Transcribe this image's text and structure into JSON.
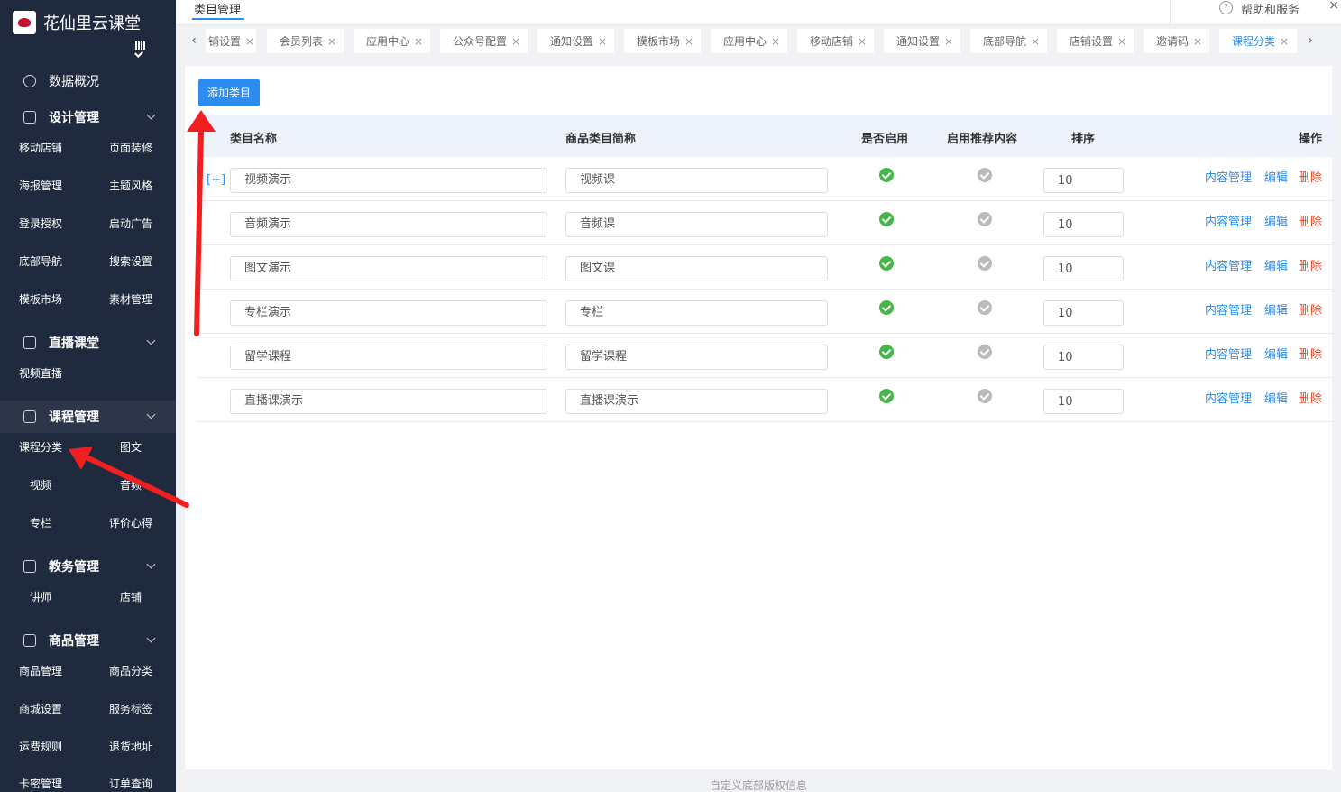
{
  "brand": {
    "name": "花仙里云课堂"
  },
  "sidebar": {
    "overview": "数据概况",
    "groups": [
      {
        "title": "设计管理",
        "items": [
          "移动店铺",
          "页面装修",
          "海报管理",
          "主题风格",
          "登录授权",
          "启动广告",
          "底部导航",
          "搜索设置",
          "模板市场",
          "素材管理"
        ]
      },
      {
        "title": "直播课堂",
        "items": [
          "视频直播"
        ]
      },
      {
        "title": "课程管理",
        "items": [
          "课程分类",
          "图文",
          "视频",
          "音频",
          "专栏",
          "评价心得"
        ]
      },
      {
        "title": "教务管理",
        "items": [
          "讲师",
          "店铺"
        ]
      },
      {
        "title": "商品管理",
        "items": [
          "商品管理",
          "商品分类",
          "商城设置",
          "服务标签",
          "运费规则",
          "退货地址",
          "卡密管理",
          "订单查询"
        ]
      }
    ]
  },
  "topbar": {
    "title": "类目管理",
    "help": "帮助和服务"
  },
  "tabs": [
    "铺设置",
    "会员列表",
    "应用中心",
    "公众号配置",
    "通知设置",
    "模板市场",
    "应用中心",
    "移动店铺",
    "通知设置",
    "底部导航",
    "店铺设置",
    "邀请码",
    "课程分类"
  ],
  "toolbar": {
    "add_label": "添加类目"
  },
  "table": {
    "headers": {
      "name": "类目名称",
      "short": "商品类目简称",
      "enabled": "是否启用",
      "recommend": "启用推荐内容",
      "sort": "排序",
      "ops": "操作"
    },
    "expand_label": "[+]",
    "actions": {
      "content": "内容管理",
      "edit": "编辑",
      "delete": "删除"
    },
    "rows": [
      {
        "name": "视频演示",
        "short": "视频课",
        "sort": "10"
      },
      {
        "name": "音频演示",
        "short": "音频课",
        "sort": "10"
      },
      {
        "name": "图文演示",
        "short": "图文课",
        "sort": "10"
      },
      {
        "name": "专栏演示",
        "short": "专栏",
        "sort": "10"
      },
      {
        "name": "留学课程",
        "short": "留学课程",
        "sort": "10"
      },
      {
        "name": "直播课演示",
        "short": "直播课演示",
        "sort": "10"
      }
    ]
  },
  "footer": {
    "text": "自定义底部版权信息"
  },
  "colors": {
    "sidebar_bg": "#1f2a3f",
    "primary": "#2d8cf0",
    "danger": "#ed4014",
    "success": "#45b649",
    "annotation": "#f02020"
  }
}
